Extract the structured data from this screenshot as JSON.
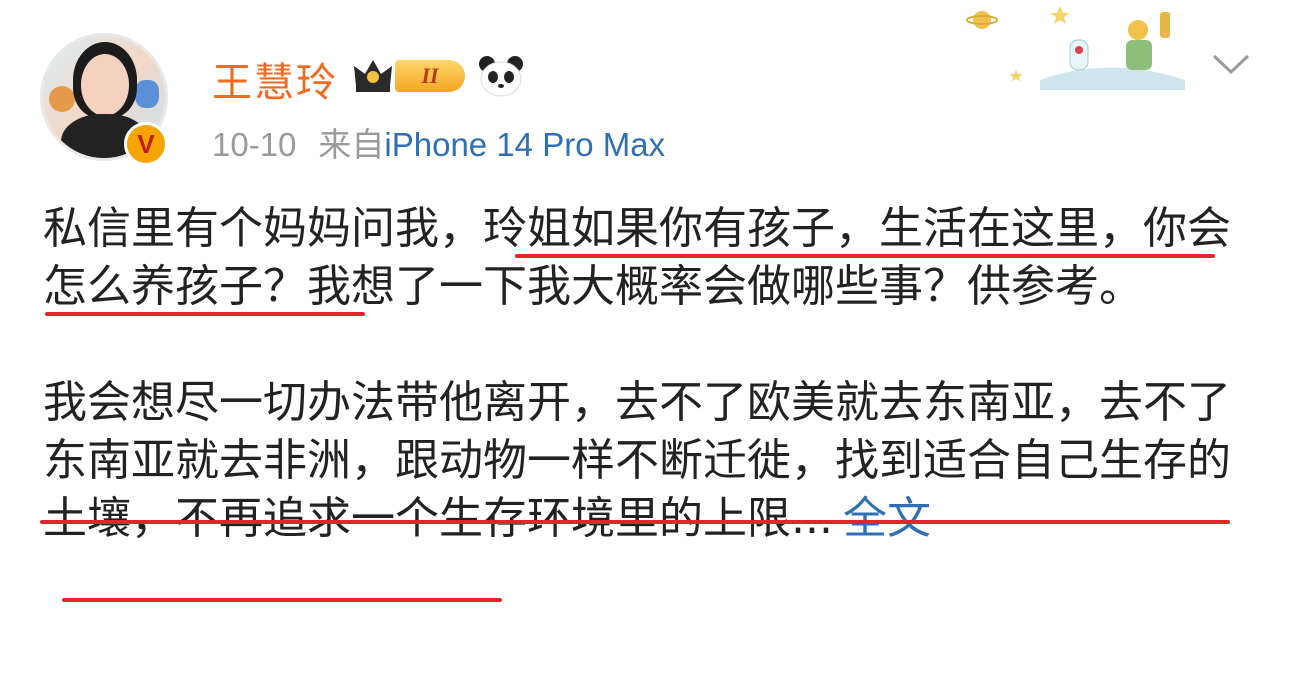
{
  "post": {
    "author": {
      "name": "王慧玲",
      "level_badge": "II",
      "verified_badge": "V",
      "accent": "#f36a1e"
    },
    "date": "10-10",
    "source_prefix": "来自",
    "source_device": "iPhone 14 Pro Max",
    "paragraph1": {
      "part1": "私信里有个妈妈问我，",
      "part2": "玲姐如果你有孩子，生活在这里，",
      "part3": "你会怎么养孩子",
      "part4": "？我想了一下我大概率会做哪些事？供参考。"
    },
    "paragraph2": {
      "part1": "我会想尽一切办法带他离开，去不了欧美就去东南亚，去不了东南亚就去非洲，",
      "part2": "跟动物一样不断迁徙，找到适合自己生存的土壤，不再追求一个生存环境里的上限...",
      "more_link": "全文"
    },
    "colors": {
      "link": "#2f6fb3",
      "underline": "#e0262a",
      "meta": "#9a9a9a"
    }
  }
}
